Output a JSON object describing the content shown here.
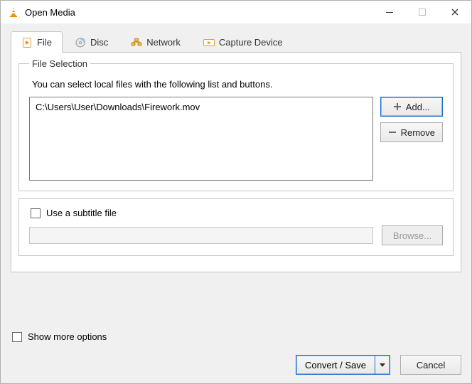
{
  "window": {
    "title": "Open Media"
  },
  "tabs": {
    "file": "File",
    "disc": "Disc",
    "network": "Network",
    "capture": "Capture Device"
  },
  "file_selection": {
    "legend": "File Selection",
    "hint": "You can select local files with the following list and buttons.",
    "files": [
      "C:\\Users\\User\\Downloads\\Firework.mov"
    ],
    "add_label": "Add...",
    "remove_label": "Remove"
  },
  "subtitle": {
    "checkbox_label": "Use a subtitle file",
    "browse_label": "Browse..."
  },
  "options": {
    "show_more_label": "Show more options"
  },
  "footer": {
    "convert_label": "Convert / Save",
    "cancel_label": "Cancel"
  }
}
